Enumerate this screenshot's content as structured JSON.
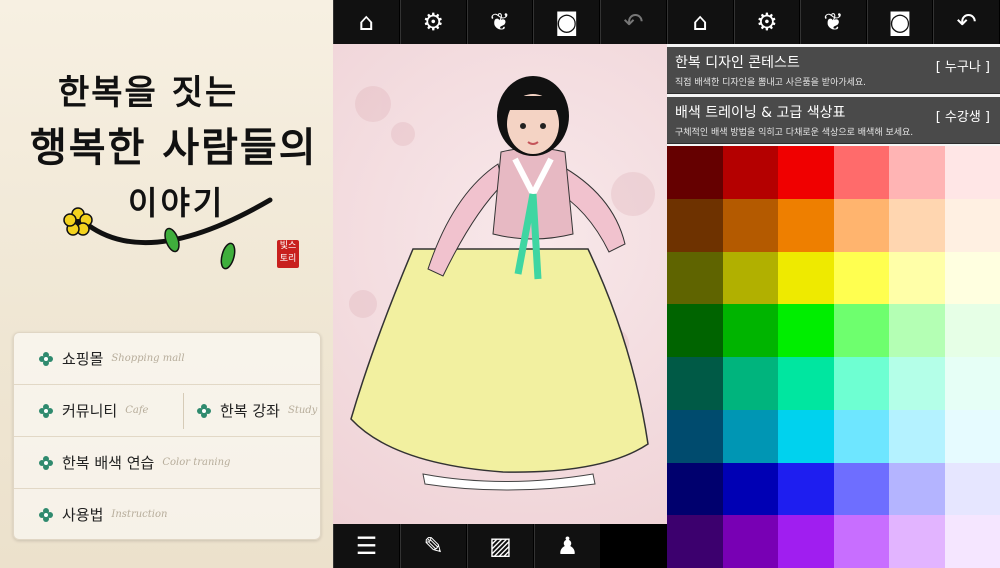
{
  "panel_home": {
    "title_line1": "한복을 짓는",
    "title_line2": "행복한 사람들의",
    "title_line3": "이야기",
    "seal_text": "빛스토리",
    "menu": [
      [
        {
          "label": "쇼핑몰",
          "sub": "Shopping mall"
        }
      ],
      [
        {
          "label": "커뮤니티",
          "sub": "Cafe"
        },
        {
          "label": "한복 강좌",
          "sub": "Study"
        }
      ],
      [
        {
          "label": "한복 배색 연습",
          "sub": "Color traning"
        }
      ],
      [
        {
          "label": "사용법",
          "sub": "Instruction"
        }
      ]
    ]
  },
  "toolbar": {
    "icons": [
      "home-icon",
      "gear-icon",
      "butterfly-icon",
      "camera-icon",
      "undo-icon"
    ]
  },
  "panel_canvas": {
    "bottom_icons": [
      "sliders-icon",
      "pencil-icon",
      "image-icon",
      "portrait-icon"
    ]
  },
  "panel_colors": {
    "banners": [
      {
        "title": "한복 디자인 콘테스트",
        "subtitle": "직접 배색한 디자인을 뽐내고 사은품을 받아가세요.",
        "tag": "[ 누구나 ]"
      },
      {
        "title": "배색 트레이닝 & 고급 색상표",
        "subtitle": "구체적인 배색 방법을 익히고 다채로운 색상으로 배색해 보세요.",
        "tag": "[ 수강생 ]"
      }
    ],
    "palette": [
      [
        "#650000",
        "#b40000",
        "#f00000",
        "#ff6b6b",
        "#ffb4b4",
        "#ffe6e6"
      ],
      [
        "#6e3200",
        "#b45a00",
        "#ee7f00",
        "#ffb46e",
        "#ffd6b0",
        "#fff0e2"
      ],
      [
        "#5f6400",
        "#b1b000",
        "#eeea00",
        "#ffff50",
        "#ffffa8",
        "#ffffe0"
      ],
      [
        "#006400",
        "#00b400",
        "#00ee00",
        "#6eff6e",
        "#b4ffb4",
        "#e6ffe6"
      ],
      [
        "#005a46",
        "#00b47d",
        "#00e6a0",
        "#6effd2",
        "#b4ffe8",
        "#e6fff6"
      ],
      [
        "#004b6e",
        "#0096b4",
        "#00d2ee",
        "#6ee6ff",
        "#b4f2ff",
        "#e6fbff"
      ],
      [
        "#00006e",
        "#0000b4",
        "#1e1ef0",
        "#6e6eff",
        "#b4b4ff",
        "#e6e6ff"
      ],
      [
        "#3c006e",
        "#7800b4",
        "#a01ef0",
        "#c86eff",
        "#e2b4ff",
        "#f5e6ff"
      ]
    ]
  }
}
